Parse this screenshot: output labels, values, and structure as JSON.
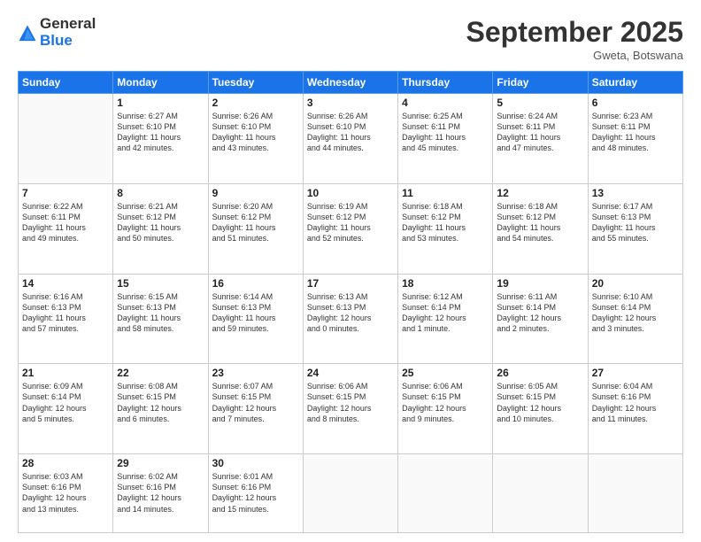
{
  "logo": {
    "general": "General",
    "blue": "Blue"
  },
  "header": {
    "title": "September 2025",
    "location": "Gweta, Botswana"
  },
  "weekdays": [
    "Sunday",
    "Monday",
    "Tuesday",
    "Wednesday",
    "Thursday",
    "Friday",
    "Saturday"
  ],
  "weeks": [
    [
      {
        "day": "",
        "info": ""
      },
      {
        "day": "1",
        "info": "Sunrise: 6:27 AM\nSunset: 6:10 PM\nDaylight: 11 hours\nand 42 minutes."
      },
      {
        "day": "2",
        "info": "Sunrise: 6:26 AM\nSunset: 6:10 PM\nDaylight: 11 hours\nand 43 minutes."
      },
      {
        "day": "3",
        "info": "Sunrise: 6:26 AM\nSunset: 6:10 PM\nDaylight: 11 hours\nand 44 minutes."
      },
      {
        "day": "4",
        "info": "Sunrise: 6:25 AM\nSunset: 6:11 PM\nDaylight: 11 hours\nand 45 minutes."
      },
      {
        "day": "5",
        "info": "Sunrise: 6:24 AM\nSunset: 6:11 PM\nDaylight: 11 hours\nand 47 minutes."
      },
      {
        "day": "6",
        "info": "Sunrise: 6:23 AM\nSunset: 6:11 PM\nDaylight: 11 hours\nand 48 minutes."
      }
    ],
    [
      {
        "day": "7",
        "info": "Sunrise: 6:22 AM\nSunset: 6:11 PM\nDaylight: 11 hours\nand 49 minutes."
      },
      {
        "day": "8",
        "info": "Sunrise: 6:21 AM\nSunset: 6:12 PM\nDaylight: 11 hours\nand 50 minutes."
      },
      {
        "day": "9",
        "info": "Sunrise: 6:20 AM\nSunset: 6:12 PM\nDaylight: 11 hours\nand 51 minutes."
      },
      {
        "day": "10",
        "info": "Sunrise: 6:19 AM\nSunset: 6:12 PM\nDaylight: 11 hours\nand 52 minutes."
      },
      {
        "day": "11",
        "info": "Sunrise: 6:18 AM\nSunset: 6:12 PM\nDaylight: 11 hours\nand 53 minutes."
      },
      {
        "day": "12",
        "info": "Sunrise: 6:18 AM\nSunset: 6:12 PM\nDaylight: 11 hours\nand 54 minutes."
      },
      {
        "day": "13",
        "info": "Sunrise: 6:17 AM\nSunset: 6:13 PM\nDaylight: 11 hours\nand 55 minutes."
      }
    ],
    [
      {
        "day": "14",
        "info": "Sunrise: 6:16 AM\nSunset: 6:13 PM\nDaylight: 11 hours\nand 57 minutes."
      },
      {
        "day": "15",
        "info": "Sunrise: 6:15 AM\nSunset: 6:13 PM\nDaylight: 11 hours\nand 58 minutes."
      },
      {
        "day": "16",
        "info": "Sunrise: 6:14 AM\nSunset: 6:13 PM\nDaylight: 11 hours\nand 59 minutes."
      },
      {
        "day": "17",
        "info": "Sunrise: 6:13 AM\nSunset: 6:13 PM\nDaylight: 12 hours\nand 0 minutes."
      },
      {
        "day": "18",
        "info": "Sunrise: 6:12 AM\nSunset: 6:14 PM\nDaylight: 12 hours\nand 1 minute."
      },
      {
        "day": "19",
        "info": "Sunrise: 6:11 AM\nSunset: 6:14 PM\nDaylight: 12 hours\nand 2 minutes."
      },
      {
        "day": "20",
        "info": "Sunrise: 6:10 AM\nSunset: 6:14 PM\nDaylight: 12 hours\nand 3 minutes."
      }
    ],
    [
      {
        "day": "21",
        "info": "Sunrise: 6:09 AM\nSunset: 6:14 PM\nDaylight: 12 hours\nand 5 minutes."
      },
      {
        "day": "22",
        "info": "Sunrise: 6:08 AM\nSunset: 6:15 PM\nDaylight: 12 hours\nand 6 minutes."
      },
      {
        "day": "23",
        "info": "Sunrise: 6:07 AM\nSunset: 6:15 PM\nDaylight: 12 hours\nand 7 minutes."
      },
      {
        "day": "24",
        "info": "Sunrise: 6:06 AM\nSunset: 6:15 PM\nDaylight: 12 hours\nand 8 minutes."
      },
      {
        "day": "25",
        "info": "Sunrise: 6:06 AM\nSunset: 6:15 PM\nDaylight: 12 hours\nand 9 minutes."
      },
      {
        "day": "26",
        "info": "Sunrise: 6:05 AM\nSunset: 6:15 PM\nDaylight: 12 hours\nand 10 minutes."
      },
      {
        "day": "27",
        "info": "Sunrise: 6:04 AM\nSunset: 6:16 PM\nDaylight: 12 hours\nand 11 minutes."
      }
    ],
    [
      {
        "day": "28",
        "info": "Sunrise: 6:03 AM\nSunset: 6:16 PM\nDaylight: 12 hours\nand 13 minutes."
      },
      {
        "day": "29",
        "info": "Sunrise: 6:02 AM\nSunset: 6:16 PM\nDaylight: 12 hours\nand 14 minutes."
      },
      {
        "day": "30",
        "info": "Sunrise: 6:01 AM\nSunset: 6:16 PM\nDaylight: 12 hours\nand 15 minutes."
      },
      {
        "day": "",
        "info": ""
      },
      {
        "day": "",
        "info": ""
      },
      {
        "day": "",
        "info": ""
      },
      {
        "day": "",
        "info": ""
      }
    ]
  ]
}
